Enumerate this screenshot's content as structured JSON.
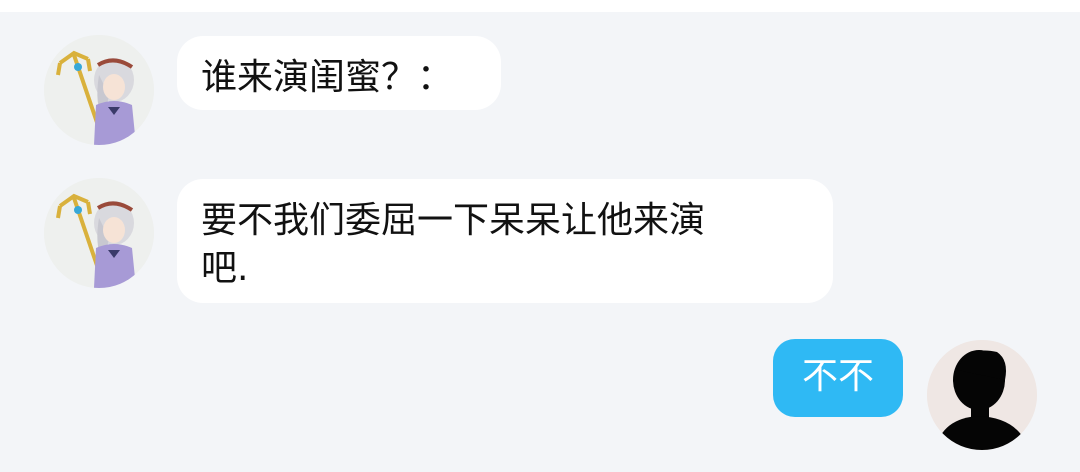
{
  "messages": [
    {
      "sender": "other",
      "text": "谁来演闺蜜？："
    },
    {
      "sender": "other",
      "text": "要不我们委屈一下呆呆让他来演\n吧."
    },
    {
      "sender": "me",
      "text": "不不"
    }
  ],
  "colors": {
    "background": "#f3f5f8",
    "bubble_incoming": "#ffffff",
    "bubble_outgoing": "#2fb9f4"
  }
}
